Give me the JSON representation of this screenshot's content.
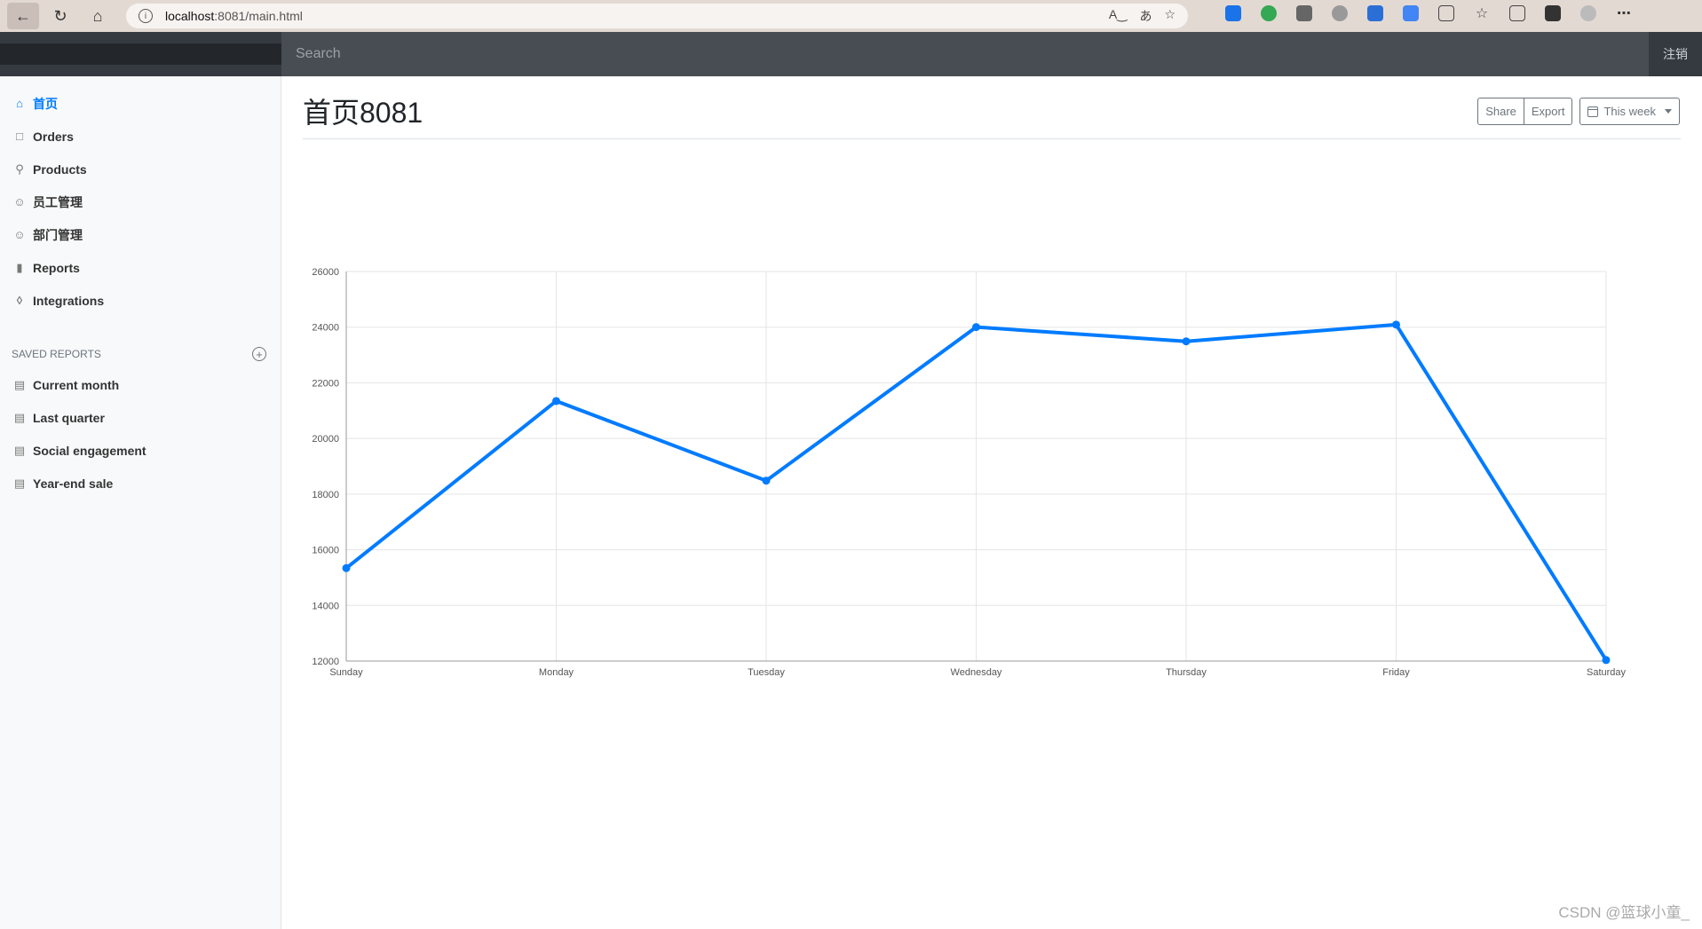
{
  "browser": {
    "url_host": "localhost",
    "url_rest": ":8081/main.html",
    "info_glyph": "i"
  },
  "navbar": {
    "search_placeholder": "Search",
    "signout_label": "注销"
  },
  "sidebar": {
    "items": [
      {
        "label": "首页",
        "icon": "home-icon",
        "active": true
      },
      {
        "label": "Orders",
        "icon": "file-icon"
      },
      {
        "label": "Products",
        "icon": "cart-icon"
      },
      {
        "label": "员工管理",
        "icon": "users-icon"
      },
      {
        "label": "部门管理",
        "icon": "users-icon"
      },
      {
        "label": "Reports",
        "icon": "bar-chart-icon"
      },
      {
        "label": "Integrations",
        "icon": "layers-icon"
      }
    ],
    "saved_heading": "SAVED REPORTS",
    "saved_items": [
      {
        "label": "Current month",
        "icon": "file-text-icon"
      },
      {
        "label": "Last quarter",
        "icon": "file-text-icon"
      },
      {
        "label": "Social engagement",
        "icon": "file-text-icon"
      },
      {
        "label": "Year-end sale",
        "icon": "file-text-icon"
      }
    ]
  },
  "main": {
    "title": "首页8081",
    "share_label": "Share",
    "export_label": "Export",
    "range_label": "This week"
  },
  "colors": {
    "accent": "#007bff",
    "navbar": "#343a40"
  },
  "watermark": "CSDN @篮球小童_",
  "chart_data": {
    "type": "line",
    "categories": [
      "Sunday",
      "Monday",
      "Tuesday",
      "Wednesday",
      "Thursday",
      "Friday",
      "Saturday"
    ],
    "series": [
      {
        "values": [
          15339,
          21345,
          18483,
          24003,
          23489,
          24092,
          12034
        ]
      }
    ],
    "ylim": [
      12000,
      26000
    ],
    "yticks": [
      12000,
      14000,
      16000,
      18000,
      20000,
      22000,
      24000,
      26000
    ],
    "grid": true,
    "legend": "none"
  }
}
